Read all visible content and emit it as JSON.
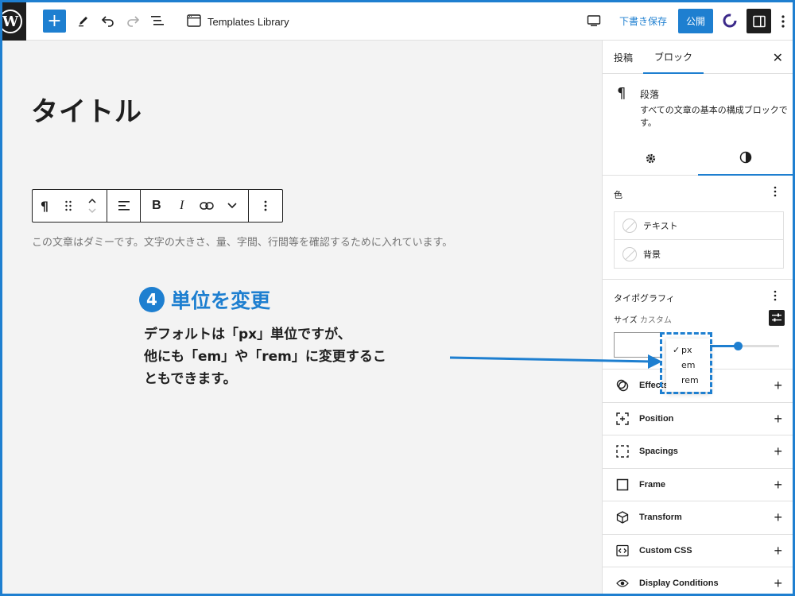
{
  "topbar": {
    "document_title": "Templates Library",
    "draft_label": "下書き保存",
    "publish_label": "公開"
  },
  "editor": {
    "post_title": "タイトル",
    "paragraph_text": "この文章はダミーです。文字の大きさ、量、字間、行間等を確認するために入れています。"
  },
  "annotation": {
    "step": "4",
    "title": "単位を変更",
    "lines": [
      "デフォルトは「px」単位ですが、",
      "他にも「em」や「rem」に変更するこ",
      "ともできます。"
    ]
  },
  "sidebar": {
    "tabs": [
      "投稿",
      "ブロック"
    ],
    "block": {
      "name": "段落",
      "description": "すべての文章の基本の構成ブロックです。"
    },
    "color": {
      "heading": "色",
      "items": [
        "テキスト",
        "背景"
      ]
    },
    "typography": {
      "heading": "タイポグラフィ",
      "size_label": "サイズ",
      "size_mode": "カスタム",
      "unit_options": [
        "px",
        "em",
        "rem"
      ],
      "selected_unit": "px"
    },
    "panels": [
      "Effects",
      "Position",
      "Spacings",
      "Frame",
      "Transform",
      "Custom CSS",
      "Display Conditions"
    ]
  },
  "colors": {
    "accent": "#1e7fd0",
    "dark": "#1e1e1e"
  }
}
